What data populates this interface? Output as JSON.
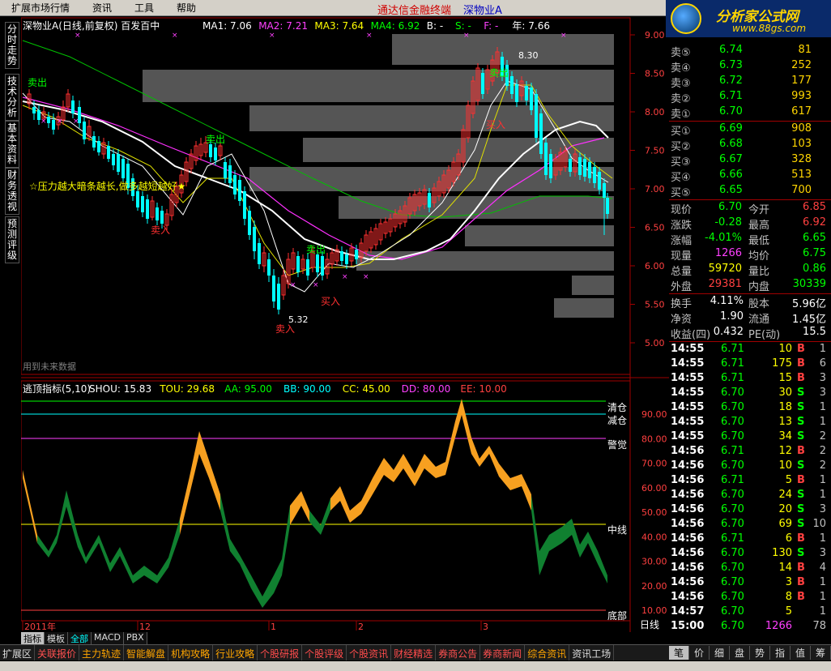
{
  "menu": [
    "扩展市场行情",
    "资讯",
    "工具",
    "帮助"
  ],
  "app_title": "通达信金融终端",
  "stock_title": "深物业A",
  "logo": {
    "text": "分析家公式网",
    "url": "www.88gs.com"
  },
  "vtabs": [
    "分时走势",
    "技术分析",
    "基本资料",
    "财务透视",
    "预测评级"
  ],
  "main_chart": {
    "header": "深物业A(日线,前复权) 百发百中",
    "ma": [
      {
        "label": "MA1: 7.06",
        "color": "#ffffff"
      },
      {
        "label": "MA2: 7.21",
        "color": "#ff40ff"
      },
      {
        "label": "MA3: 7.64",
        "color": "#ffff00"
      },
      {
        "label": "MA4: 6.92",
        "color": "#00ff00"
      },
      {
        "label": "B: -",
        "color": "#ffffff"
      },
      {
        "label": "S: -",
        "color": "#00ff00"
      },
      {
        "label": "F: -",
        "color": "#ff40ff"
      },
      {
        "label": "年: 7.66",
        "color": "#ffffff"
      }
    ],
    "y_ticks": [
      "9.00",
      "8.50",
      "8.00",
      "7.50",
      "7.00",
      "6.50",
      "6.00",
      "5.50",
      "5.00"
    ],
    "annotation": "☆压力越大暗条越长,做多越短越好★",
    "future_note": "用到未来数据",
    "high_label": "8.30",
    "low_label": "5.32",
    "sell_label": "卖出",
    "buy_label": "买入",
    "red_sell": "卖入"
  },
  "indicator": {
    "header_name": "逃顶指标(5,10)",
    "params": [
      {
        "label": "SHOU: 15.83",
        "color": "#ffffff"
      },
      {
        "label": "TOU: 29.68",
        "color": "#ffff00"
      },
      {
        "label": "AA: 95.00",
        "color": "#00ff00"
      },
      {
        "label": "BB: 90.00",
        "color": "#00ffff"
      },
      {
        "label": "CC: 45.00",
        "color": "#ffff00"
      },
      {
        "label": "DD: 80.00",
        "color": "#ff40ff"
      },
      {
        "label": "EE: 10.00",
        "color": "#ff4040"
      }
    ],
    "y_ticks": [
      "90.00",
      "80.00",
      "70.00",
      "60.00",
      "50.00",
      "40.00",
      "30.00",
      "20.00",
      "10.00"
    ],
    "line_labels": {
      "clear": "清仓",
      "reduce": "减仓",
      "alert": "警觉",
      "mid": "中线",
      "bottom": "底部"
    }
  },
  "x_axis": {
    "labels": [
      "2011年",
      "12",
      "1",
      "2",
      "3"
    ],
    "period": "日线"
  },
  "quotes": {
    "asks": [
      {
        "label": "卖⑤",
        "price": "6.74",
        "vol": "81"
      },
      {
        "label": "卖④",
        "price": "6.73",
        "vol": "252"
      },
      {
        "label": "卖③",
        "price": "6.72",
        "vol": "177"
      },
      {
        "label": "卖②",
        "price": "6.71",
        "vol": "993"
      },
      {
        "label": "卖①",
        "price": "6.70",
        "vol": "617"
      }
    ],
    "bids": [
      {
        "label": "买①",
        "price": "6.69",
        "vol": "908"
      },
      {
        "label": "买②",
        "price": "6.68",
        "vol": "103"
      },
      {
        "label": "买③",
        "price": "6.67",
        "vol": "328"
      },
      {
        "label": "买④",
        "price": "6.66",
        "vol": "513"
      },
      {
        "label": "买⑤",
        "price": "6.65",
        "vol": "700"
      }
    ]
  },
  "stats": [
    {
      "l1": "现价",
      "v1": "6.70",
      "c1": "#00ff00",
      "l2": "今开",
      "v2": "6.85",
      "c2": "#ff4040"
    },
    {
      "l1": "涨跌",
      "v1": "-0.28",
      "c1": "#00ff00",
      "l2": "最高",
      "v2": "6.92",
      "c2": "#ff4040"
    },
    {
      "l1": "涨幅",
      "v1": "-4.01%",
      "c1": "#00ff00",
      "l2": "最低",
      "v2": "6.65",
      "c2": "#00ff00"
    },
    {
      "l1": "现量",
      "v1": "1266",
      "c1": "#ff40ff",
      "l2": "均价",
      "v2": "6.75",
      "c2": "#00ff00"
    },
    {
      "l1": "总量",
      "v1": "59720",
      "c1": "#ffff00",
      "l2": "量比",
      "v2": "0.86",
      "c2": "#00ff00"
    },
    {
      "l1": "外盘",
      "v1": "29381",
      "c1": "#ff4040",
      "l2": "内盘",
      "v2": "30339",
      "c2": "#00ff00"
    }
  ],
  "stats2": [
    {
      "l1": "换手",
      "v1": "4.11%",
      "l2": "股本",
      "v2": "5.96亿"
    },
    {
      "l1": "净资",
      "v1": "1.90",
      "l2": "流通",
      "v2": "1.45亿"
    },
    {
      "l1": "收益(四)",
      "v1": "0.432",
      "l2": "PE(动)",
      "v2": "15.5"
    }
  ],
  "ticks": [
    {
      "t": "14:55",
      "p": "6.71",
      "v": "10",
      "s": "B",
      "n": "1"
    },
    {
      "t": "14:55",
      "p": "6.71",
      "v": "175",
      "s": "B",
      "n": "6"
    },
    {
      "t": "14:55",
      "p": "6.71",
      "v": "15",
      "s": "B",
      "n": "3"
    },
    {
      "t": "14:55",
      "p": "6.70",
      "v": "30",
      "s": "S",
      "n": "3"
    },
    {
      "t": "14:55",
      "p": "6.70",
      "v": "18",
      "s": "S",
      "n": "1"
    },
    {
      "t": "14:55",
      "p": "6.70",
      "v": "13",
      "s": "S",
      "n": "1"
    },
    {
      "t": "14:55",
      "p": "6.70",
      "v": "34",
      "s": "S",
      "n": "2"
    },
    {
      "t": "14:56",
      "p": "6.71",
      "v": "12",
      "s": "B",
      "n": "2"
    },
    {
      "t": "14:56",
      "p": "6.70",
      "v": "10",
      "s": "S",
      "n": "2"
    },
    {
      "t": "14:56",
      "p": "6.71",
      "v": "5",
      "s": "B",
      "n": "1"
    },
    {
      "t": "14:56",
      "p": "6.70",
      "v": "24",
      "s": "S",
      "n": "1"
    },
    {
      "t": "14:56",
      "p": "6.70",
      "v": "20",
      "s": "S",
      "n": "3"
    },
    {
      "t": "14:56",
      "p": "6.70",
      "v": "69",
      "s": "S",
      "n": "10"
    },
    {
      "t": "14:56",
      "p": "6.71",
      "v": "6",
      "s": "B",
      "n": "1"
    },
    {
      "t": "14:56",
      "p": "6.70",
      "v": "130",
      "s": "S",
      "n": "3"
    },
    {
      "t": "14:56",
      "p": "6.70",
      "v": "14",
      "s": "B",
      "n": "4"
    },
    {
      "t": "14:56",
      "p": "6.70",
      "v": "3",
      "s": "B",
      "n": "1"
    },
    {
      "t": "14:56",
      "p": "6.70",
      "v": "8",
      "s": "B",
      "n": "1"
    },
    {
      "t": "14:57",
      "p": "6.70",
      "v": "5",
      "s": "",
      "n": "1"
    },
    {
      "t": "15:00",
      "p": "6.70",
      "v": "1266",
      "s": "",
      "n": "78"
    }
  ],
  "subtabs": [
    "指标",
    "模板",
    "全部",
    "MACD",
    "PBX"
  ],
  "bottom_tabs": [
    "扩展区",
    "关联报价",
    "主力轨迹",
    "智能解盘",
    "机构攻略",
    "行业攻略",
    "个股研报",
    "个股评级",
    "个股资讯",
    "财经精选",
    "券商公告",
    "券商新闻",
    "综合资讯",
    "资讯工场"
  ],
  "right_tabs": [
    "笔",
    "价",
    "细",
    "盘",
    "势",
    "指",
    "值",
    "筹"
  ]
}
